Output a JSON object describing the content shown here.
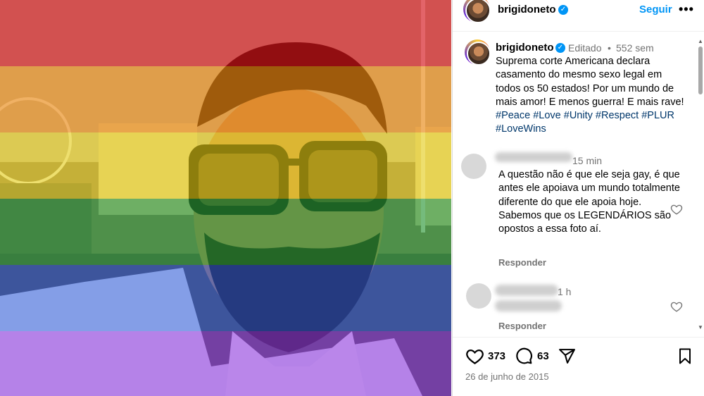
{
  "post": {
    "username": "brigidoneto",
    "follow_label": "Seguir",
    "more_label": "•••",
    "edited_label": "Editado",
    "dot": "•",
    "age": "552 sem",
    "caption_text": "Suprema corte Americana declara casamento do mesmo sexo legal em todos os 50 estados! Por um mundo de mais amor! E menos guerra! E mais rave!",
    "hashtags": [
      "#Peace",
      "#Love",
      "#Unity",
      "#Respect",
      "#PLUR",
      "#LoveWins"
    ],
    "likes": "373",
    "comments_count": "63",
    "date": "26 de junho de 2015"
  },
  "comments": [
    {
      "time": "15 min",
      "text": "A questão não é que ele seja gay, é que antes ele apoiava um mundo totalmente diferente do que ele apoia hoje. Sabemos que os LEGENDÁRIOS são opostos a essa foto aí.",
      "reply_label": "Responder"
    },
    {
      "time": "1 h",
      "text": "",
      "reply_label": "Responder"
    }
  ],
  "icons": {
    "verified": "verified-badge-icon",
    "like": "heart-icon",
    "comment": "comment-bubble-icon",
    "share": "paper-plane-icon",
    "save": "bookmark-icon"
  },
  "colors": {
    "link": "#0095f6",
    "hashtag": "#00376b",
    "muted": "#737373",
    "rainbow": [
      "#e8000a",
      "#ff8c00",
      "#ffe100",
      "#1f9e2c",
      "#1f4fe0",
      "#8a2be2"
    ]
  }
}
